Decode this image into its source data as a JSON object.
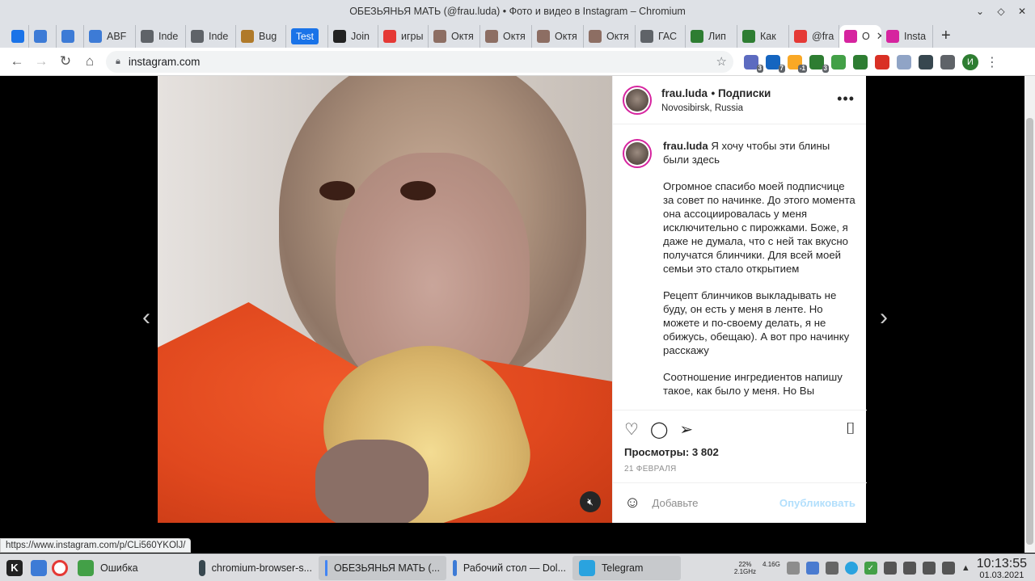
{
  "window": {
    "title": "ОБЕЗЬЯНЬЯ МАТЬ (@frau.luda) • Фото и видео в Instagram – Chromium"
  },
  "tabs": [
    {
      "label": "",
      "icon": "o-icon",
      "color": "#1a73e8"
    },
    {
      "label": "",
      "icon": "cube-icon",
      "color": "#3d7bd6"
    },
    {
      "label": "",
      "icon": "cube-icon",
      "color": "#3d7bd6"
    },
    {
      "label": "ABF",
      "icon": "cube-icon",
      "color": "#3d7bd6"
    },
    {
      "label": "Inde",
      "icon": "globe-icon",
      "color": "#5f6368"
    },
    {
      "label": "Inde",
      "icon": "globe-icon",
      "color": "#5f6368"
    },
    {
      "label": "Bug",
      "icon": "bug-icon",
      "color": "#b07a2a"
    },
    {
      "label": "Test",
      "icon": "",
      "color": "#1a73e8"
    },
    {
      "label": "Join",
      "icon": "construction-icon",
      "color": "#222"
    },
    {
      "label": "игры",
      "icon": "yandex-icon",
      "color": "#e53935"
    },
    {
      "label": "Октя",
      "icon": "scales-icon",
      "color": "#8d6e63"
    },
    {
      "label": "Октя",
      "icon": "scales-icon",
      "color": "#8d6e63"
    },
    {
      "label": "Октя",
      "icon": "scales-icon",
      "color": "#8d6e63"
    },
    {
      "label": "Октя",
      "icon": "scales-icon",
      "color": "#8d6e63"
    },
    {
      "label": "ГАС",
      "icon": "globe-icon",
      "color": "#5f6368"
    },
    {
      "label": "Лип",
      "icon": "48-icon",
      "color": "#2e7d32"
    },
    {
      "label": "Как",
      "icon": "48-icon",
      "color": "#2e7d32"
    },
    {
      "label": "@fra",
      "icon": "yandex-icon",
      "color": "#e53935"
    },
    {
      "label": "О",
      "icon": "instagram-icon",
      "color": "#d6249f",
      "active": true
    },
    {
      "label": "Insta",
      "icon": "instagram-icon",
      "color": "#d6249f"
    }
  ],
  "address": {
    "url": "instagram.com"
  },
  "extensions": [
    {
      "name": "mail-icon",
      "badge": "3",
      "color": "#5c6bc0"
    },
    {
      "name": "sync-icon",
      "badge": "7",
      "color": "#1565c0"
    },
    {
      "name": "weather-icon",
      "badge": "-1",
      "color": "#f9a825"
    },
    {
      "name": "shield-icon",
      "badge": "3",
      "color": "#2e7d32"
    },
    {
      "name": "grid-icon",
      "badge": "",
      "color": "#43a047"
    },
    {
      "name": "record-icon",
      "badge": "",
      "color": "#2e7d32"
    },
    {
      "name": "gmail-icon",
      "badge": "",
      "color": "#d93025"
    },
    {
      "name": "vk-icon",
      "badge": "",
      "color": "#90a4c6"
    },
    {
      "name": "camera-icon",
      "badge": "",
      "color": "#37474f"
    },
    {
      "name": "puzzle-icon",
      "badge": "",
      "color": "#5f6368"
    }
  ],
  "profile_initial": "И",
  "post": {
    "username": "frau.luda",
    "follow_label": "• Подписки",
    "location": "Novosibirsk, Russia",
    "caption_first": "Я хочу чтобы эти блины были здесь",
    "paragraphs": [
      "Огромное спасибо моей подписчице за совет по начинке. До этого момента она ассоциировалась у меня исключительно с пирожками. Боже, я даже не думала, что с ней так вкусно получатся блинчики. Для всей моей семьи это стало открытием",
      "Рецепт блинчиков выкладывать не буду, он есть у меня в ленте. Но можете и по-своему делать, я не обижусь, обещаю). А вот про начинку расскажу",
      "Соотношение ингредиентов напишу такое, как было у меня. Но Вы"
    ],
    "views": "Просмотры: 3 802",
    "date": "21 ФЕВРАЛЯ",
    "comment_placeholder": "Добавьте",
    "publish_label": "Опубликовать"
  },
  "status_url": "https://www.instagram.com/p/CLi560YKOlJ/",
  "taskbar": {
    "items": [
      {
        "label": "Ошибка",
        "icon": "error-icon",
        "color": "#43a047"
      },
      {
        "label": "chromium-browser-s...",
        "icon": "terminal-icon",
        "color": "#37474f"
      },
      {
        "label": "ОБЕЗЬЯНЬЯ МАТЬ (...",
        "icon": "chromium-icon",
        "color": "#4285f4",
        "active": true
      },
      {
        "label": "Рабочий стол — Dol...",
        "icon": "folder-icon",
        "color": "#3d7bd6"
      },
      {
        "label": "Telegram",
        "icon": "telegram-icon",
        "color": "#2aa3df",
        "active": true
      }
    ],
    "cpu": "22%",
    "freq": "2.1GHz",
    "mem": "4.16G",
    "time": "10:13:55",
    "date": "01.03.2021"
  }
}
